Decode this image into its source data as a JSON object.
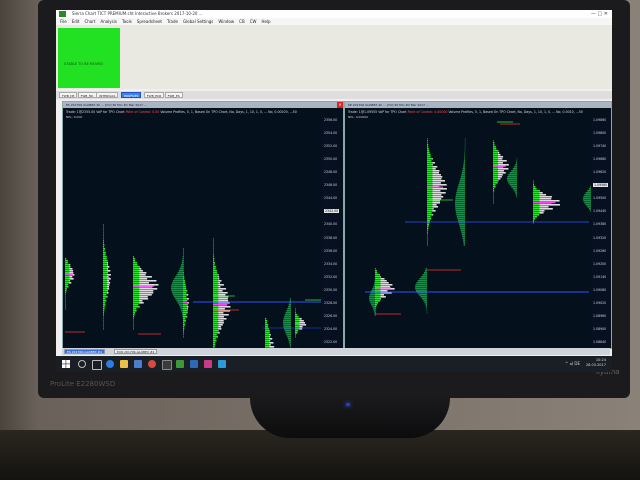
{
  "app": {
    "title": "Sierra Chart TICT PREMIUM.cht  Interactive Brokers 2017-10-20 ..."
  },
  "menu": [
    "File",
    "Edit",
    "Chart",
    "Analysis",
    "Tools",
    "Spreadsheet",
    "Trade",
    "Global Settings",
    "Window",
    "CB",
    "CW",
    "Help"
  ],
  "control_panel": {
    "status_text": "STABLE TO BE MOVED"
  },
  "page_tabs": [
    {
      "label": "FWB_DE",
      "active": false
    },
    {
      "label": "FWB_MC",
      "active": false
    },
    {
      "label": "INTERVALS",
      "active": false
    },
    {
      "label": "PROFILES",
      "active": true
    },
    {
      "label": "FWB_EUR",
      "active": false
    },
    {
      "label": "FWB_ES",
      "active": false
    }
  ],
  "charts": {
    "left": {
      "window_title": "ES 201706 GLOBEX 4h ...  [CV] 30 Min #1  Mar 2017 ...",
      "info_prefix": "Trade: 1@2355.00  VaP for TPO Chart",
      "info_poc": "Point of Control: 0.00",
      "info_suffix": "Volume Profiles, 5, 1, Based On TPO Chart, No, Days, 1, 10, 1, 0, ... No, 0.00100, ...50",
      "npl": "NPL: 0.000",
      "axis_labels": [
        {
          "label": "2356.00",
          "highlight": false
        },
        {
          "label": "2354.00",
          "highlight": false
        },
        {
          "label": "2352.00",
          "highlight": false
        },
        {
          "label": "2350.00",
          "highlight": false
        },
        {
          "label": "2348.00",
          "highlight": false
        },
        {
          "label": "2346.00",
          "highlight": false
        },
        {
          "label": "2344.00",
          "highlight": false
        },
        {
          "label": "2342.00",
          "highlight": true
        },
        {
          "label": "2340.00",
          "highlight": false
        },
        {
          "label": "2338.00",
          "highlight": false
        },
        {
          "label": "2336.00",
          "highlight": false
        },
        {
          "label": "2334.00",
          "highlight": false
        },
        {
          "label": "2332.00",
          "highlight": false
        },
        {
          "label": "2330.00",
          "highlight": false
        },
        {
          "label": "2328.00",
          "highlight": false
        },
        {
          "label": "2326.00",
          "highlight": false
        },
        {
          "label": "2324.00",
          "highlight": false
        },
        {
          "label": "2322.00",
          "highlight": false
        }
      ]
    },
    "right": {
      "window_title": "6E 201706 GLOBEX 4h ...  [CV] 30 Min #2  Mar 2017 ...",
      "info_prefix": "Trade: 1@1.09555  VaP for TPO Chart",
      "info_poc": "Point of Control: 0.00000",
      "info_suffix": "Volume Profiles, 5, 1, Based On TPO Chart, No, Days, 1, 10, 1, 0, ... No, 0.0010, ...50",
      "npl": "NPL: 0.00000",
      "axis_labels": [
        {
          "label": "1.09860",
          "highlight": false
        },
        {
          "label": "1.09800",
          "highlight": false
        },
        {
          "label": "1.09740",
          "highlight": false
        },
        {
          "label": "1.09680",
          "highlight": false
        },
        {
          "label": "1.09620",
          "highlight": false
        },
        {
          "label": "1.09560",
          "highlight": true
        },
        {
          "label": "1.09500",
          "highlight": false
        },
        {
          "label": "1.09440",
          "highlight": false
        },
        {
          "label": "1.09380",
          "highlight": false
        },
        {
          "label": "1.09320",
          "highlight": false
        },
        {
          "label": "1.09260",
          "highlight": false
        },
        {
          "label": "1.09200",
          "highlight": false
        },
        {
          "label": "1.09140",
          "highlight": false
        },
        {
          "label": "1.09080",
          "highlight": false
        },
        {
          "label": "1.09020",
          "highlight": false
        },
        {
          "label": "1.08960",
          "highlight": false
        },
        {
          "label": "1.08900",
          "highlight": false
        },
        {
          "label": "1.08840",
          "highlight": false
        }
      ]
    }
  },
  "chart_tabs": [
    {
      "label": "ES 201706-GLOBEX  #1",
      "active": true
    },
    {
      "label": "EUR 201706-GLOBEX  #2",
      "active": false
    }
  ],
  "taskbar": {
    "time": "10:24",
    "date": "28.03.2017",
    "tray": "^  ◂)  DE"
  },
  "monitor": {
    "brand": "ProLite E2280WSD",
    "maker": "iiyama"
  },
  "colors": {
    "chart_bg": "#05101d",
    "profile_green": "#2fe02f",
    "profile_white": "#dcdcdc",
    "poc_magenta": "#ff40ff",
    "level_red": "#ff3030",
    "level_blue": "#3050ff",
    "accent_green": "#22e022"
  }
}
